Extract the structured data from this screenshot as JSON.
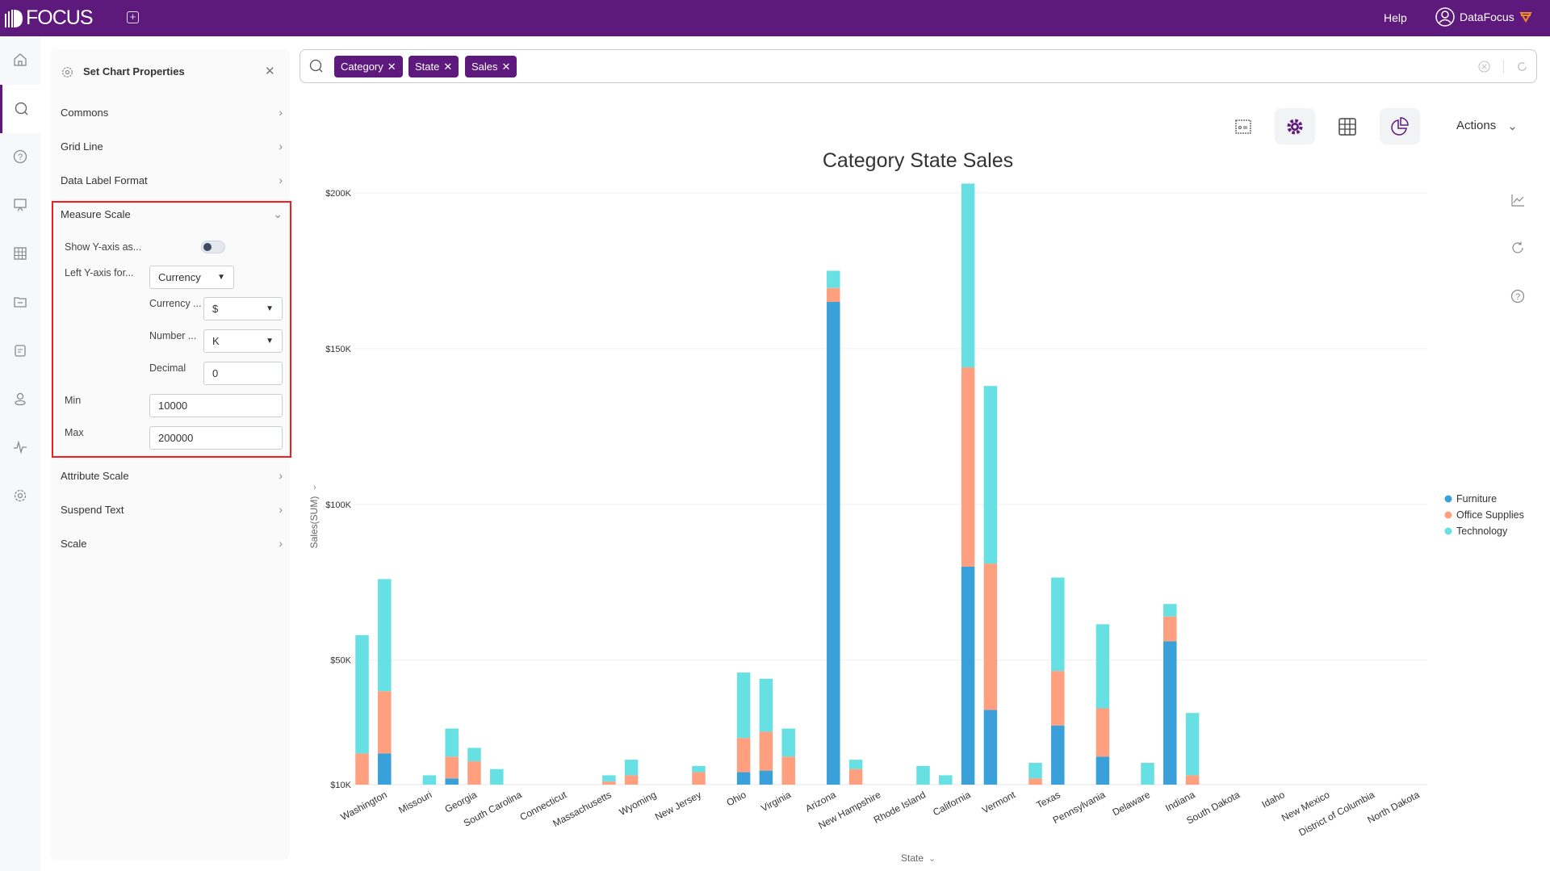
{
  "app": {
    "logo": "FOCUS",
    "help": "Help",
    "user": "DataFocus"
  },
  "rail": {
    "icons": [
      "home-icon",
      "search-icon",
      "help-icon",
      "presentation-icon",
      "table-icon",
      "folder-icon",
      "clipboard-icon",
      "user-icon",
      "pulse-icon",
      "settings-icon"
    ],
    "active": "search-icon"
  },
  "panel": {
    "title": "Set Chart Properties",
    "items": {
      "commons": "Commons",
      "grid_line": "Grid Line",
      "data_label_format": "Data Label Format",
      "measure_scale": "Measure Scale",
      "attribute_scale": "Attribute Scale",
      "suspend_text": "Suspend Text",
      "scale": "Scale"
    },
    "measure": {
      "show_y_label": "Show Y-axis as...",
      "show_y_on": false,
      "left_y_label": "Left Y-axis for...",
      "left_y_value": "Currency",
      "currency_label": "Currency ...",
      "currency_value": "$",
      "number_label": "Number ...",
      "number_value": "K",
      "decimal_label": "Decimal",
      "decimal_value": "0",
      "min_label": "Min",
      "min_value": "10000",
      "max_label": "Max",
      "max_value": "200000"
    }
  },
  "search": {
    "chips": [
      "Category",
      "State",
      "Sales"
    ]
  },
  "toolbar": {
    "actions": "Actions"
  },
  "colors": {
    "brand": "#5d197c",
    "furniture": "#3aa0d9",
    "office": "#fe9f7f",
    "technology": "#66e0e3",
    "highlight": "#f21d1d"
  },
  "chart_data": {
    "type": "bar",
    "stacked": true,
    "title": "Category State Sales",
    "xlabel": "State",
    "ylabel": "Sales(SUM)",
    "ylim": [
      10000,
      200000
    ],
    "yticks": [
      "$10K",
      "$50K",
      "$100K",
      "$150K",
      "$200K"
    ],
    "ytick_values": [
      10000,
      50000,
      100000,
      150000,
      200000
    ],
    "grid": true,
    "legend": "right",
    "categories": [
      "",
      "Washington",
      "",
      "Missouri",
      "",
      "Georgia",
      "",
      "South Carolina",
      "",
      "Connecticut",
      "",
      "Massachusetts",
      "",
      "Wyoming",
      "",
      "New Jersey",
      "",
      "Ohio",
      "",
      "Virginia",
      "",
      "Arizona",
      "",
      "New Hampshire",
      "",
      "Rhode Island",
      "",
      "California",
      "",
      "Vermont",
      "",
      "Texas",
      "",
      "Pennsylvania",
      "",
      "Delaware",
      "",
      "Indiana",
      "",
      "South Dakota",
      "",
      "Idaho",
      "",
      "New Mexico",
      "",
      "District of Columbia",
      "",
      "North Dakota"
    ],
    "series": [
      {
        "name": "Furniture",
        "color": "#3aa0d9",
        "values": [
          0,
          20000,
          0,
          0,
          12000,
          0,
          0,
          0,
          0,
          0,
          0,
          0,
          0,
          0,
          0,
          0,
          0,
          14000,
          14500,
          0,
          0,
          165000,
          0,
          0,
          0,
          0,
          0,
          80000,
          34000,
          0,
          0,
          29000,
          0,
          19000,
          0,
          0,
          56000,
          0,
          0,
          0,
          0,
          0,
          0,
          0,
          0,
          0,
          0,
          0
        ]
      },
      {
        "name": "Office Supplies",
        "color": "#fe9f7f",
        "values": [
          20000,
          20000,
          0,
          0,
          7000,
          17500,
          0,
          0,
          0,
          0,
          0,
          11000,
          13000,
          0,
          0,
          14000,
          0,
          11000,
          12500,
          19000,
          0,
          4500,
          15000,
          0,
          0,
          0,
          0,
          64000,
          47000,
          0,
          12000,
          17500,
          0,
          15500,
          0,
          0,
          8000,
          13000,
          0,
          0,
          0,
          0,
          0,
          0,
          0,
          0,
          0,
          0
        ]
      },
      {
        "name": "Technology",
        "color": "#66e0e3",
        "values": [
          38000,
          36000,
          0,
          13000,
          9000,
          4300,
          15000,
          0,
          0,
          0,
          0,
          2000,
          5000,
          0,
          0,
          2000,
          0,
          21000,
          17000,
          9000,
          0,
          5500,
          3000,
          0,
          0,
          16000,
          13000,
          59000,
          57000,
          0,
          5000,
          30000,
          0,
          27000,
          0,
          17000,
          4000,
          20000,
          0,
          0,
          0,
          0,
          0,
          0,
          0,
          0,
          0,
          0
        ]
      }
    ]
  }
}
